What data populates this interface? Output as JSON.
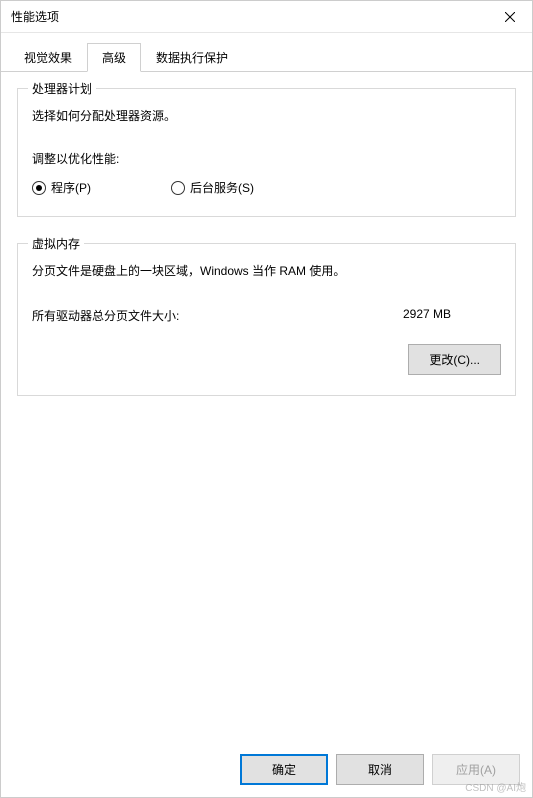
{
  "window": {
    "title": "性能选项"
  },
  "tabs": {
    "visual": "视觉效果",
    "advanced": "高级",
    "dep": "数据执行保护"
  },
  "processor": {
    "group_title": "处理器计划",
    "desc": "选择如何分配处理器资源。",
    "adjust_label": "调整以优化性能:",
    "radio_programs": "程序(P)",
    "radio_services": "后台服务(S)"
  },
  "vm": {
    "group_title": "虚拟内存",
    "desc": "分页文件是硬盘上的一块区域，Windows 当作 RAM 使用。",
    "total_label": "所有驱动器总分页文件大小:",
    "total_value": "2927 MB",
    "change_btn": "更改(C)..."
  },
  "footer": {
    "ok": "确定",
    "cancel": "取消",
    "apply": "应用(A)"
  },
  "watermark": "CSDN @AI炮"
}
